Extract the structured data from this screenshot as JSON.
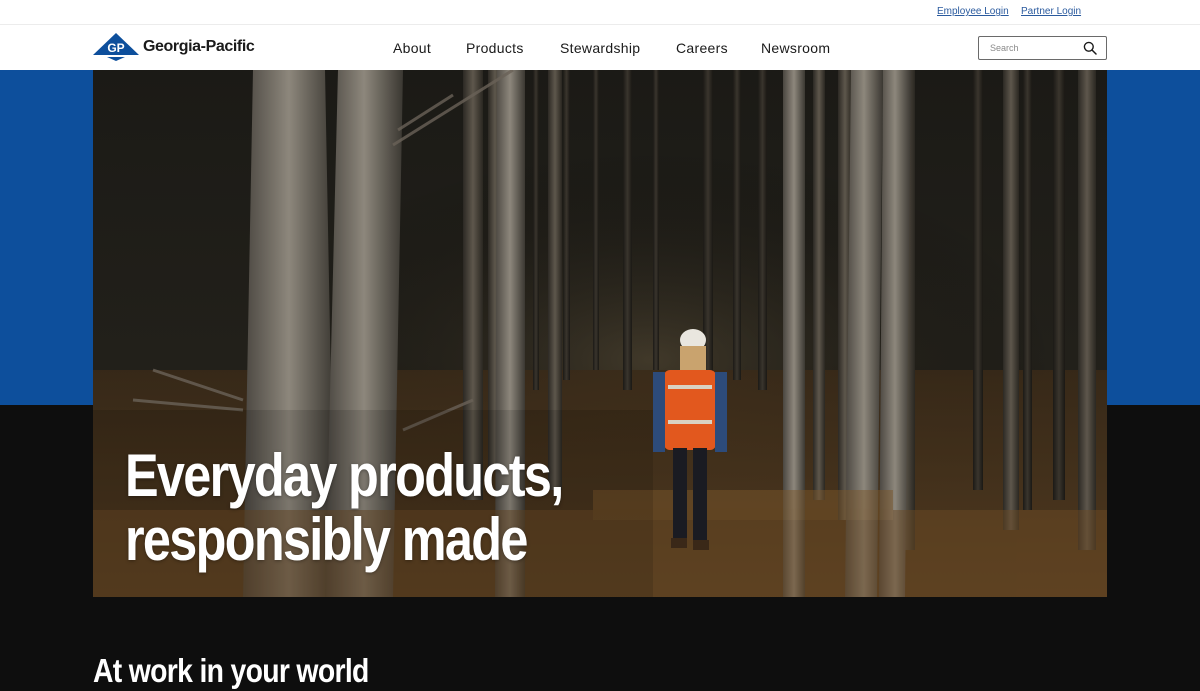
{
  "utility": {
    "employee_login": "Employee Login",
    "partner_login": "Partner Login"
  },
  "header": {
    "logo_text": "Georgia-Pacific",
    "logo_mark": "GP",
    "nav": [
      "About",
      "Products",
      "Stewardship",
      "Careers",
      "Newsroom"
    ],
    "search": {
      "placeholder": "Search",
      "value": ""
    }
  },
  "hero": {
    "headline_line1": "Everyday products,",
    "headline_line2": "responsibly made",
    "image": "forest-worker-walking-between-pine-trees"
  },
  "section": {
    "title": "At work in your world"
  },
  "colors": {
    "brand_blue": "#0d4f9c",
    "dark_band": "#0e0e0e",
    "link_blue": "#2a5a9e"
  },
  "icons": {
    "search": "search-icon",
    "logo": "gp-logo-icon"
  }
}
